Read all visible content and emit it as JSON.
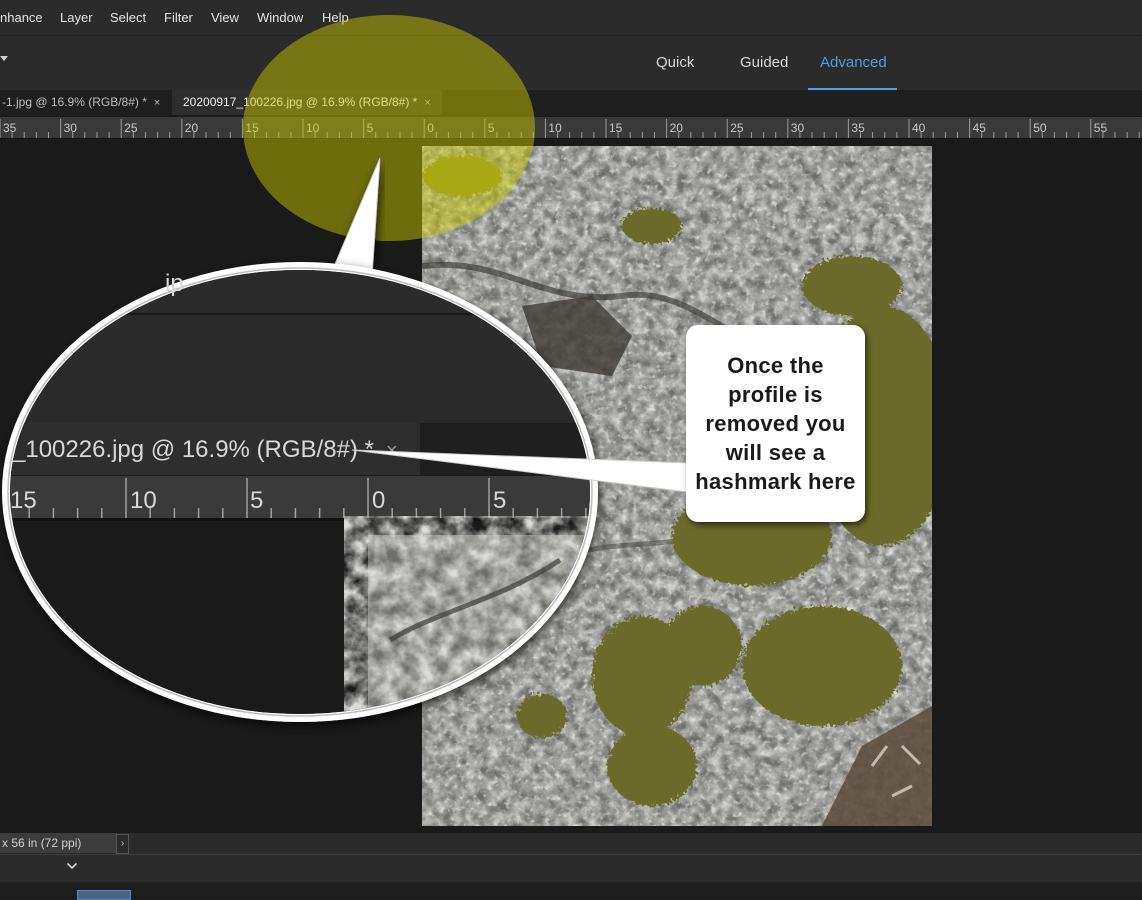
{
  "menubar": {
    "items": [
      "nhance",
      "Layer",
      "Select",
      "Filter",
      "View",
      "Window",
      "Help"
    ]
  },
  "modes": {
    "quick": "Quick",
    "guided": "Guided",
    "advanced": "Advanced",
    "active": "Advanced"
  },
  "tabs": [
    {
      "label": "-1.jpg @ 16.9% (RGB/8#) *",
      "close": "×",
      "active": false
    },
    {
      "label": "20200917_100226.jpg @ 16.9% (RGB/8#) *",
      "close": "×",
      "active": true
    }
  ],
  "ruler": {
    "labels": [
      "35",
      "30",
      "25",
      "20",
      "15",
      "10",
      "5",
      "0",
      "5",
      "10",
      "15",
      "20",
      "25",
      "30",
      "35",
      "40",
      "45",
      "50",
      "55"
    ]
  },
  "status": {
    "doc_size": "x 56 in (72 ppi)",
    "arrow": "›"
  },
  "zoom": {
    "menu_fragment": "ip",
    "tab_label": "_100226.jpg @ 16.9% (RGB/8#) *",
    "close": "×",
    "ruler_labels": [
      "15",
      "10",
      "5",
      "0",
      "5"
    ]
  },
  "callout": {
    "text": "Once the profile is removed you will see a hashmark here"
  },
  "colors": {
    "accent": "#4a9fe8",
    "highlight": "#c8c800",
    "moss": "#6b6a2a"
  }
}
